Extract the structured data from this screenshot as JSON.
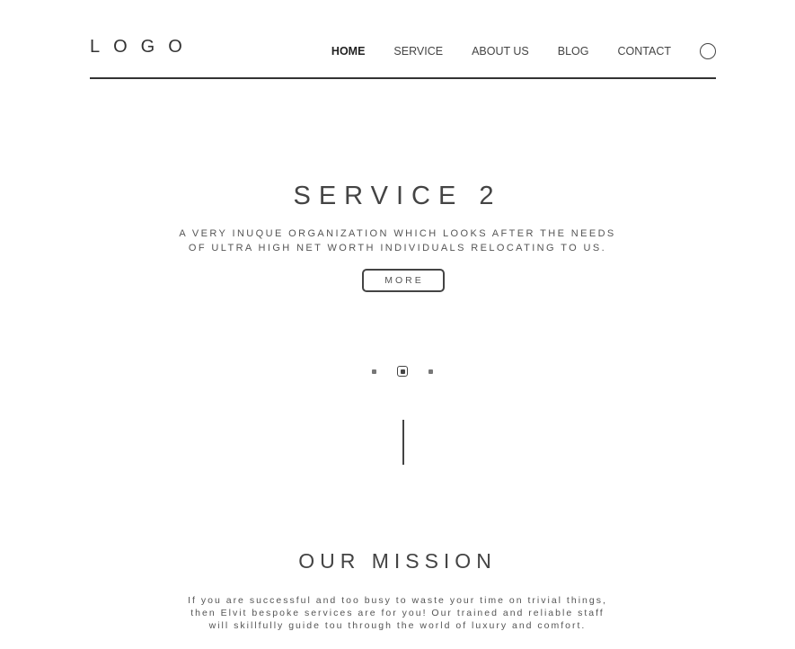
{
  "header": {
    "logo": "LOGO",
    "nav": [
      {
        "label": "HOME",
        "active": true
      },
      {
        "label": "SERVICE",
        "active": false
      },
      {
        "label": "ABOUT US",
        "active": false
      },
      {
        "label": "BLOG",
        "active": false
      },
      {
        "label": "CONTACT",
        "active": false
      }
    ],
    "search_icon": "circle-search-icon"
  },
  "hero": {
    "title": "SERVICE 2",
    "subtitle_lines": [
      "A VERY INUQUE ORGANIZATION WHICH LOOKS AFTER THE NEEDS",
      "OF ULTRA HIGH NET WORTH INDIVIDUALS RELOCATING TO US."
    ],
    "more_label": "MORE"
  },
  "slider": {
    "count": 3,
    "active_index": 2
  },
  "mission": {
    "title": "OUR MISSION",
    "text_lines": [
      "If you are successful and too busy to waste your time on trivial things,",
      "then Elvit bespoke services are for you! Our trained and reliable staff",
      "will skillfully guide tou through the world of luxury and comfort."
    ]
  },
  "colors": {
    "text": "#3a3a3a",
    "line": "#333333",
    "background": "#ffffff"
  }
}
